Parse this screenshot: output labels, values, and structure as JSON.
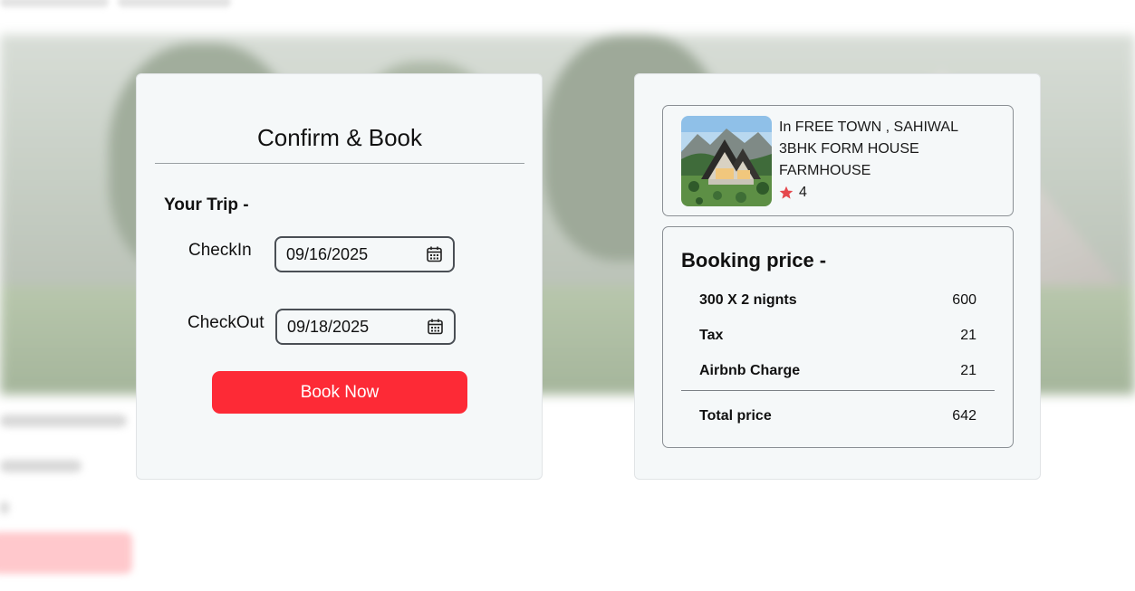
{
  "booking": {
    "title": "Confirm & Book",
    "trip_heading": "Your Trip -",
    "checkin_label": "CheckIn",
    "checkin_value": "09/16/2025",
    "checkout_label": "CheckOut",
    "checkout_value": "09/18/2025",
    "book_button": "Book Now"
  },
  "listing": {
    "location": "In FREE TOWN , SAHIWAL",
    "name": "3BHK FORM HOUSE",
    "category": "FARMHOUSE",
    "rating": "4"
  },
  "price": {
    "heading": "Booking price -",
    "rows": [
      {
        "label": "300 X 2 nignts",
        "value": "600"
      },
      {
        "label": "Tax",
        "value": "21"
      },
      {
        "label": "Airbnb Charge",
        "value": "21"
      }
    ],
    "total_label": "Total price",
    "total_value": "642"
  },
  "colors": {
    "accent": "#fd2a36",
    "star": "#e5484d",
    "panel_bg": "#f5f8f9"
  },
  "icons": {
    "date": "calendar-icon",
    "rating": "star-icon"
  }
}
